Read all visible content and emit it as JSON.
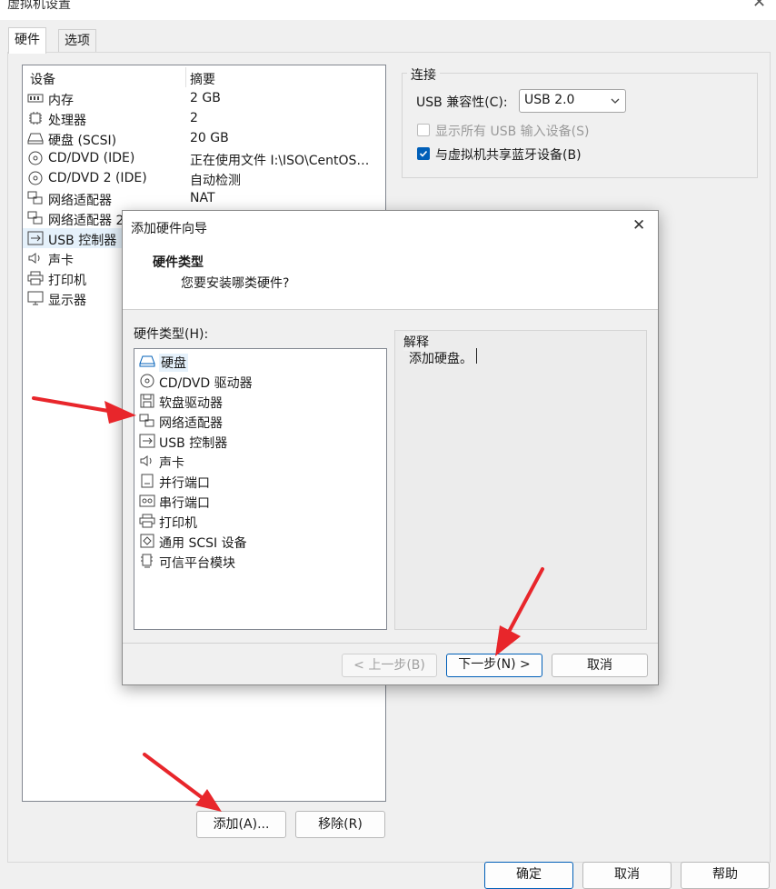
{
  "window": {
    "title": "虚拟机设置"
  },
  "tabs": [
    {
      "label": "硬件",
      "active": true
    },
    {
      "label": "选项",
      "active": false
    }
  ],
  "device_list": {
    "columns": [
      "设备",
      "摘要"
    ],
    "rows": [
      {
        "name": "内存",
        "summary": "2 GB",
        "icon": "memory-icon"
      },
      {
        "name": "处理器",
        "summary": "2",
        "icon": "cpu-icon"
      },
      {
        "name": "硬盘 (SCSI)",
        "summary": "20 GB",
        "icon": "hard-disk-icon"
      },
      {
        "name": "CD/DVD (IDE)",
        "summary": "正在使用文件 I:\\ISO\\CentOS…",
        "icon": "disc-icon"
      },
      {
        "name": "CD/DVD 2 (IDE)",
        "summary": "自动检测",
        "icon": "disc-icon"
      },
      {
        "name": "网络适配器",
        "summary": "NAT",
        "icon": "network-icon"
      },
      {
        "name": "网络适配器 2",
        "summary": "",
        "icon": "network-icon"
      },
      {
        "name": "USB 控制器",
        "summary": "",
        "icon": "usb-icon"
      },
      {
        "name": "声卡",
        "summary": "",
        "icon": "sound-icon"
      },
      {
        "name": "打印机",
        "summary": "",
        "icon": "printer-icon"
      },
      {
        "name": "显示器",
        "summary": "",
        "icon": "monitor-icon"
      }
    ]
  },
  "buttons": {
    "add": "添加(A)...",
    "remove": "移除(R)",
    "ok": "确定",
    "cancel": "取消",
    "help": "帮助"
  },
  "connection": {
    "group_label": "连接",
    "usb_compat_label": "USB 兼容性(C):",
    "usb_compat_value": "USB 2.0",
    "show_all_label": "显示所有 USB 输入设备(S)",
    "show_all_checked": false,
    "share_bt_label": "与虚拟机共享蓝牙设备(B)",
    "share_bt_checked": true
  },
  "dialog": {
    "title": "添加硬件向导",
    "heading": "硬件类型",
    "subheading": "您要安装哪类硬件?",
    "list_label": "硬件类型(H):",
    "items": [
      {
        "name": "硬盘",
        "icon": "hard-disk-icon",
        "selected": true
      },
      {
        "name": "CD/DVD 驱动器",
        "icon": "disc-icon"
      },
      {
        "name": "软盘驱动器",
        "icon": "floppy-icon"
      },
      {
        "name": "网络适配器",
        "icon": "network-icon"
      },
      {
        "name": "USB 控制器",
        "icon": "usb-icon"
      },
      {
        "name": "声卡",
        "icon": "sound-icon"
      },
      {
        "name": "并行端口",
        "icon": "parallel-port-icon"
      },
      {
        "name": "串行端口",
        "icon": "serial-port-icon"
      },
      {
        "name": "打印机",
        "icon": "printer-icon"
      },
      {
        "name": "通用 SCSI 设备",
        "icon": "scsi-icon"
      },
      {
        "name": "可信平台模块",
        "icon": "tpm-icon"
      }
    ],
    "desc_label": "解释",
    "desc_text": "添加硬盘。",
    "back": "< 上一步(B)",
    "next": "下一步(N) >",
    "cancel": "取消"
  },
  "colors": {
    "accent": "#005fb8",
    "annotation_arrow": "#e8262b",
    "selection": "#e5f1fb"
  }
}
